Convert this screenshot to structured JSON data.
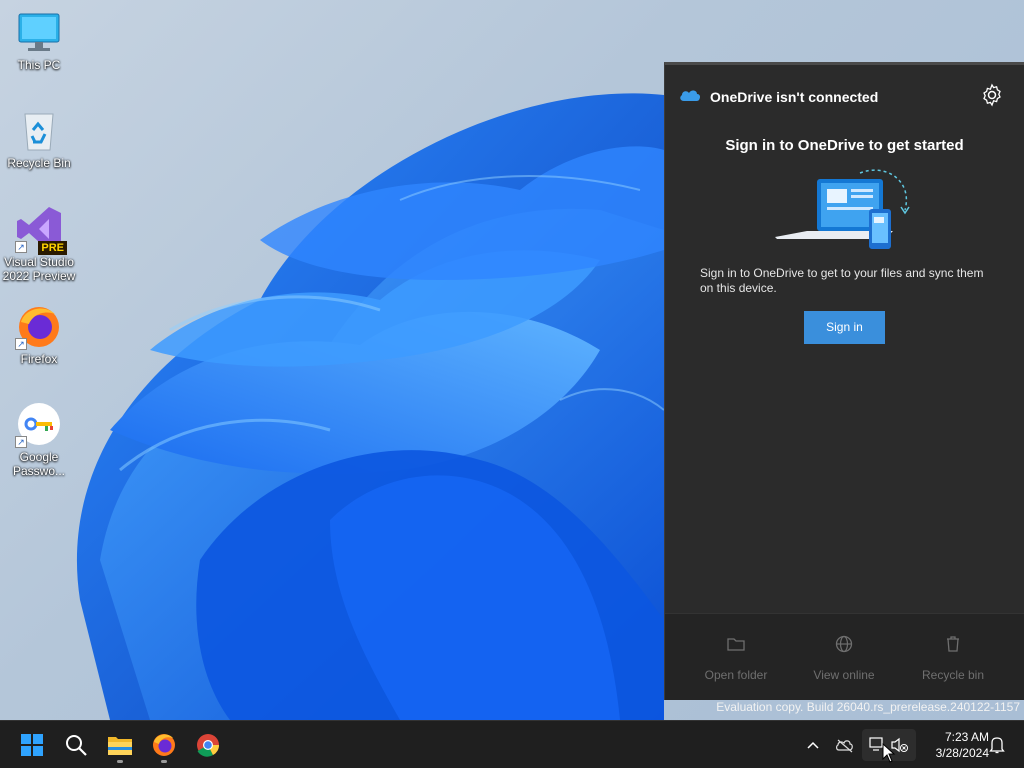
{
  "desktop": {
    "icons": [
      {
        "label": "This PC",
        "icon": "this-pc-icon"
      },
      {
        "label": "Recycle Bin",
        "icon": "recycle-bin-icon"
      },
      {
        "label": "Visual Studio 2022 Preview",
        "icon": "visual-studio-icon",
        "badge": "PRE"
      },
      {
        "label": "Firefox",
        "icon": "firefox-icon"
      },
      {
        "label": "Google Passwo...",
        "icon": "google-password-manager-icon"
      }
    ],
    "watermark": "Evaluation copy. Build 26040.rs_prerelease.240122-1157"
  },
  "onedrive": {
    "title": "OneDrive isn't connected",
    "heading": "Sign in to OneDrive to get started",
    "description": "Sign in to OneDrive to get to your files and sync them on this device.",
    "signin_label": "Sign in",
    "footer": {
      "open_folder": "Open folder",
      "view_online": "View online",
      "recycle_bin": "Recycle bin"
    }
  },
  "taskbar": {
    "apps": [
      "start-icon",
      "search-icon",
      "file-explorer-icon",
      "firefox-icon",
      "chrome-icon"
    ],
    "clock": {
      "time": "7:23 AM",
      "date": "3/28/2024"
    }
  },
  "colors": {
    "accent": "#3a8fdc",
    "flyout_bg": "#2b2b2b",
    "taskbar_bg": "#1f1f1f"
  }
}
